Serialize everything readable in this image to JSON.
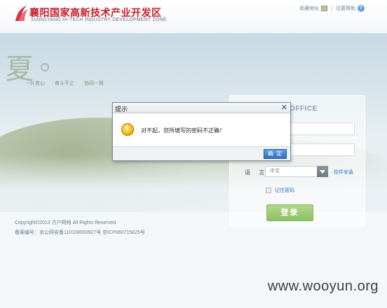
{
  "header": {
    "logo_cn": "襄阳国家高新技术产业开发区",
    "logo_en": "XIANGYANG HI-TECH INDUSTRY DEVELOPMENT ZONE",
    "nav": {
      "bookmark": "收藏地址",
      "set_home": "设置帮助"
    }
  },
  "hero": {
    "season_char": "夏",
    "slogans": [
      "一片杏心",
      "奋斗不止",
      "协同一致"
    ]
  },
  "login": {
    "title": "OFFICE",
    "language_label": "语 言",
    "language_value": "中文",
    "plugin_link": "控件安装",
    "remember_label": "记住密码",
    "submit": "登录"
  },
  "footer": {
    "copyright": "Copyright©2013 方户网络 All Rights Reserved",
    "icp": "备案编号：京公网安备110108000927号 京ICP060715625号"
  },
  "dialog": {
    "title": "提示",
    "close_glyph": "✕",
    "icon_glyph": "!",
    "message": "对不起，您所填写的密码不正确！",
    "ok": "确 定"
  },
  "watermark": "www.wooyun.org",
  "colors": {
    "brand_red": "#c9202b",
    "link_blue": "#2d78c4",
    "login_green": "#8cc063",
    "dialog_button": "#2f6fbe"
  }
}
